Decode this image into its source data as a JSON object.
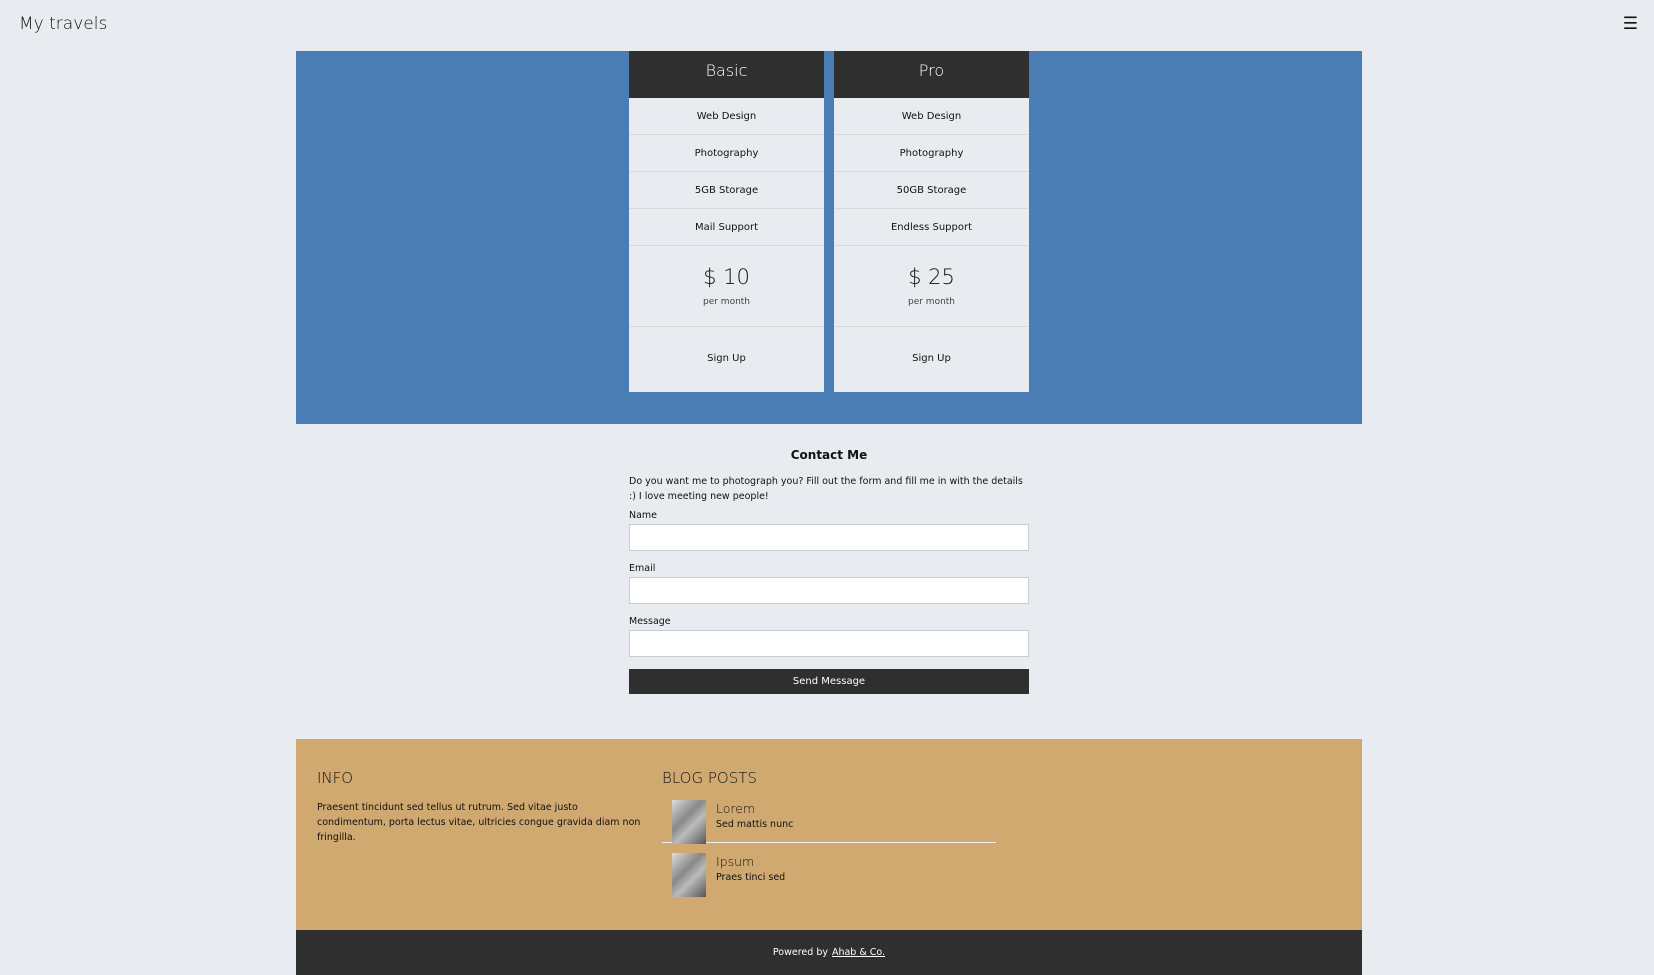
{
  "header": {
    "title": "My travels",
    "menu_icon": "☰"
  },
  "pricing": {
    "plans": [
      {
        "name": "Basic",
        "features": [
          "Web Design",
          "Photography",
          "5GB Storage",
          "Mail Support"
        ],
        "price": "$ 10",
        "period": "per month",
        "cta": "Sign Up"
      },
      {
        "name": "Pro",
        "features": [
          "Web Design",
          "Photography",
          "50GB Storage",
          "Endless Support"
        ],
        "price": "$ 25",
        "period": "per month",
        "cta": "Sign Up"
      }
    ]
  },
  "contact": {
    "title": "Contact Me",
    "intro": "Do you want me to photograph you? Fill out the form and fill me in with the details :) I love meeting new people!",
    "fields": {
      "name_label": "Name",
      "name_value": "",
      "email_label": "Email",
      "email_value": "",
      "message_label": "Message",
      "message_value": ""
    },
    "submit_label": "Send Message"
  },
  "footer": {
    "info_title": "INFO",
    "info_text": "Praesent tincidunt sed tellus ut rutrum. Sed vitae justo condimentum, porta lectus vitae, ultricies congue gravida diam non fringilla.",
    "blog_title": "BLOG POSTS",
    "posts": [
      {
        "title": "Lorem",
        "subtitle": "Sed mattis nunc"
      },
      {
        "title": "Ipsum",
        "subtitle": "Praes tinci sed"
      }
    ]
  },
  "credits": {
    "prefix": "Powered by",
    "link": "Ahab & Co."
  },
  "colors": {
    "background": "#e8ecf0",
    "pricing_band": "#4a7db3",
    "dark": "#2f2f2f",
    "footer": "#cfa970"
  }
}
